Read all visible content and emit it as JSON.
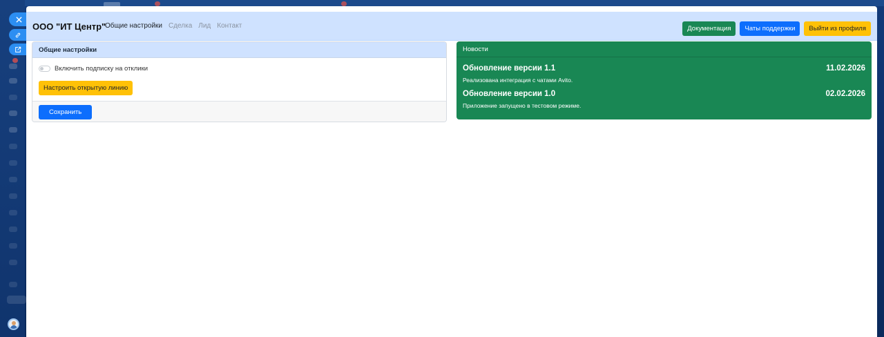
{
  "app": {
    "brand": "ООО \"ИТ Центр\"",
    "nav_links": [
      "Общие настройки",
      "Сделка",
      "Лид",
      "Контакт"
    ],
    "active_nav": "Общие настройки",
    "buttons": {
      "docs": "Документация",
      "support": "Чаты поддержки",
      "logout": "Выйти из профиля"
    }
  },
  "settings": {
    "title": "Общие настройки",
    "toggle_label": "Включить подписку на отклики",
    "toggle_on": false,
    "configure_button": "Настроить открытую линию",
    "save_button": "Сохранить"
  },
  "news": {
    "title": "Новости",
    "items": [
      {
        "title": "Обновление версии 1.1",
        "date": "11.02.2026",
        "text": "Реализована интеграция с чатами Avito."
      },
      {
        "title": "Обновление версии 1.0",
        "date": "02.02.2026",
        "text": "Приложение запущено в тестовом режиме."
      }
    ]
  },
  "colors": {
    "primary": "#0d6efd",
    "success": "#198754",
    "warning": "#ffc107",
    "header_bg": "#cfe2ff"
  },
  "icons": {
    "close": "close-icon",
    "link": "link-icon",
    "external": "external-link-icon"
  }
}
